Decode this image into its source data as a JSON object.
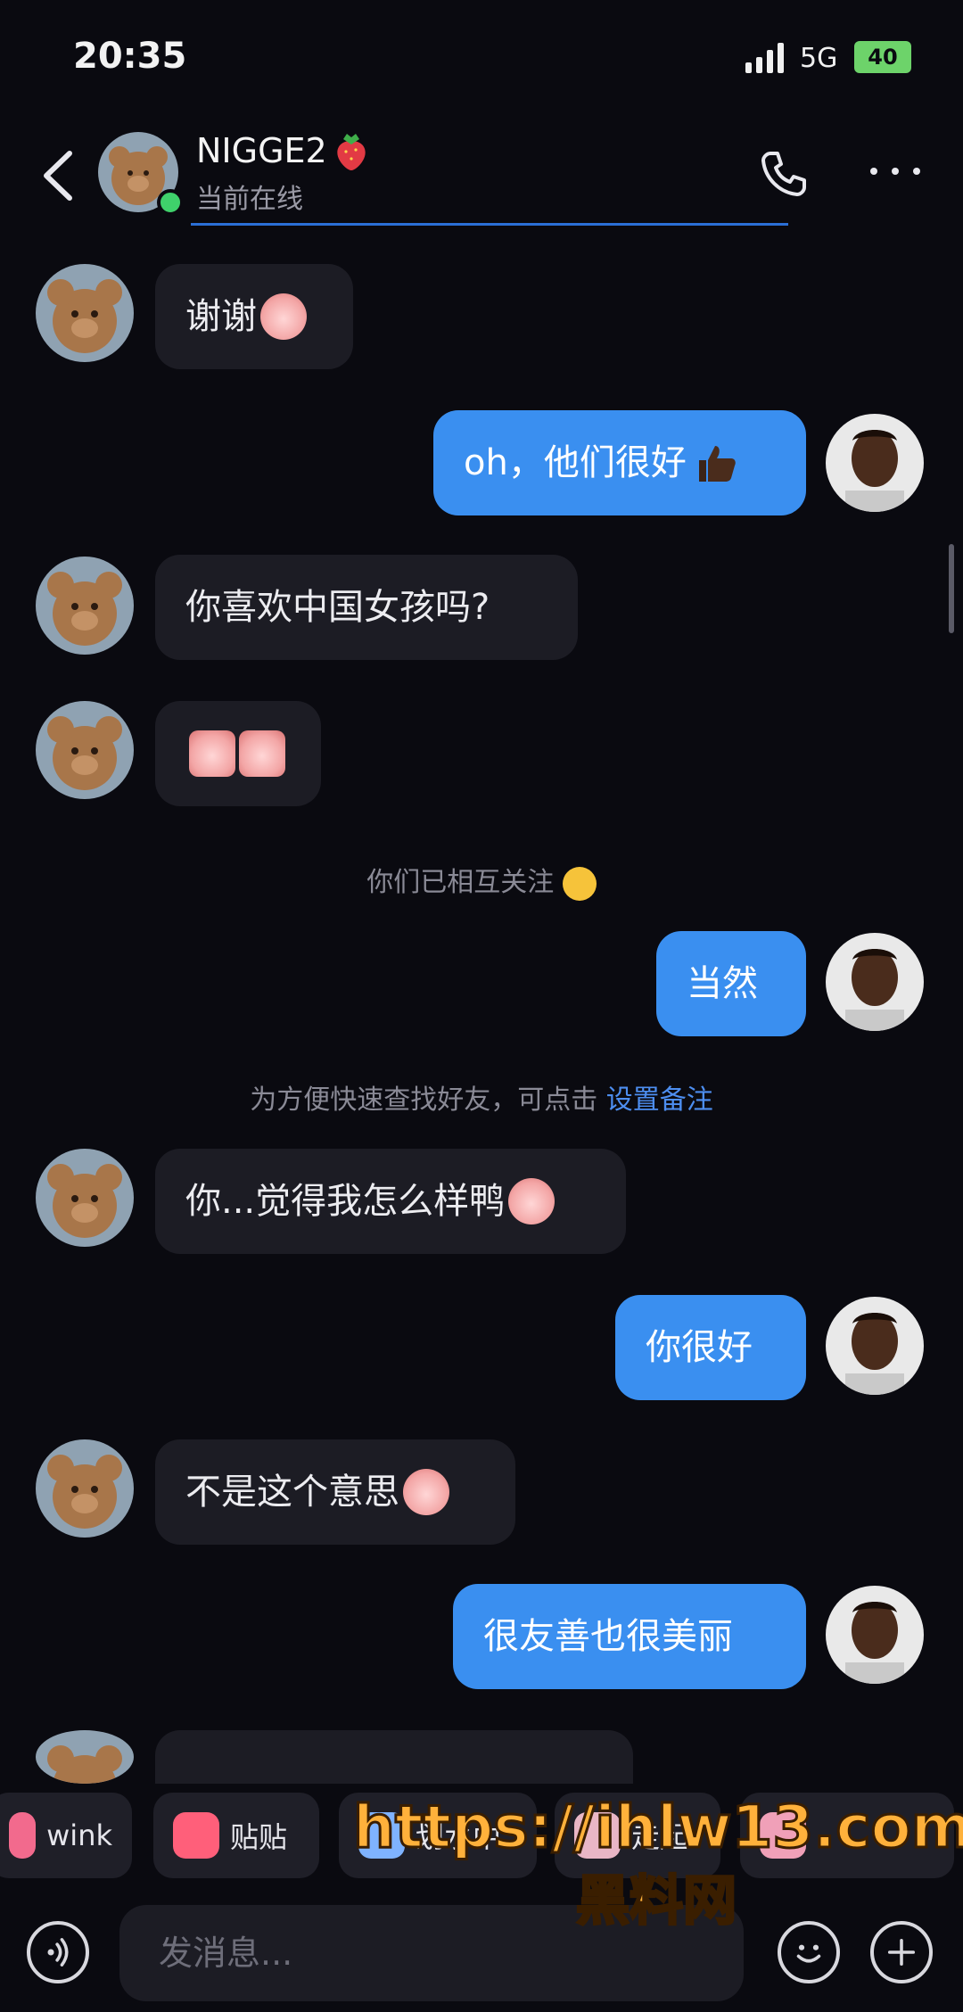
{
  "status_bar": {
    "time": "20:35",
    "network": "5G",
    "battery": "40"
  },
  "header": {
    "contact_name": "NIGGE2",
    "contact_status": "当前在线",
    "back_icon": "chevron-left-icon",
    "call_icon": "phone-icon",
    "more_icon": "more-dots-icon"
  },
  "messages": [
    {
      "side": "in",
      "text": "谢谢"
    },
    {
      "side": "out",
      "text": "oh，他们很好"
    },
    {
      "side": "in",
      "text": "你喜欢中国女孩吗?"
    },
    {
      "side": "in",
      "text": ""
    },
    {
      "side": "out",
      "text": "当然"
    },
    {
      "side": "in",
      "text": "你...觉得我怎么样鸭"
    },
    {
      "side": "out",
      "text": "你很好"
    },
    {
      "side": "in",
      "text": "不是这个意思"
    },
    {
      "side": "out",
      "text": "很友善也很美丽"
    }
  ],
  "system": {
    "mutual_follow": "你们已相互关注",
    "remark_hint": "为方便快速查找好友，可点击",
    "remark_link": "设置备注"
  },
  "quick_replies": [
    "wink",
    "贴贴",
    "划水中",
    "走起"
  ],
  "input": {
    "placeholder": "发消息..."
  },
  "watermark": {
    "url": "https://ihlw13.com",
    "site": "黑料网"
  },
  "colors": {
    "outgoing_bubble": "#3a8ff0",
    "incoming_bubble": "#1c1c24",
    "online": "#3fd16b",
    "link": "#4d8ef0"
  }
}
